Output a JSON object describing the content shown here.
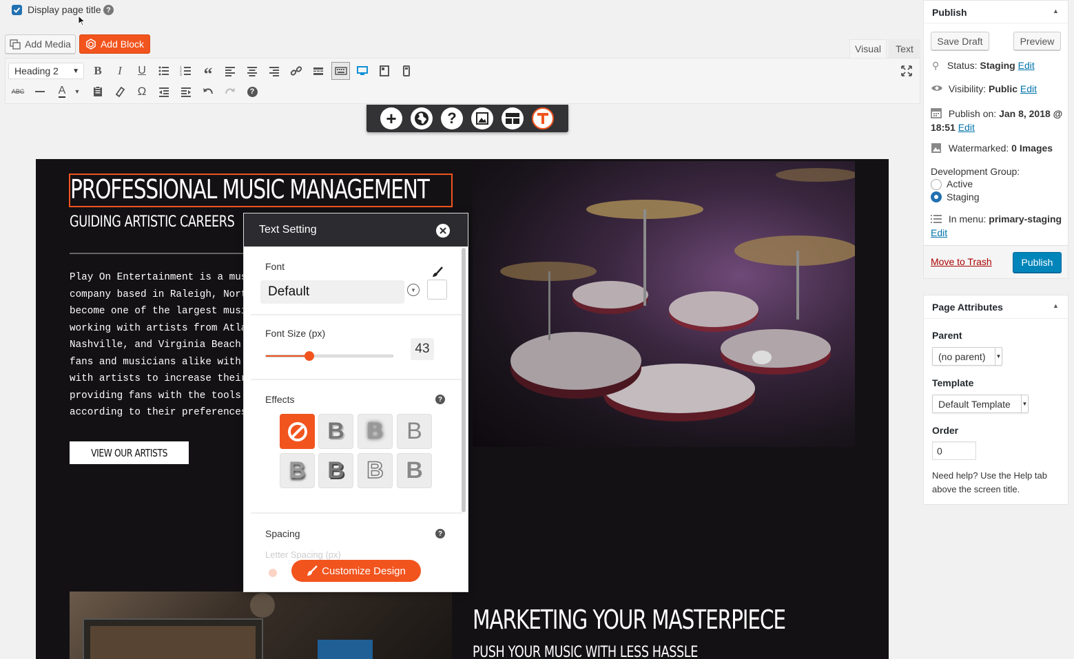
{
  "top": {
    "display_title_label": "Display page title",
    "add_media": "Add Media",
    "add_block": "Add Block",
    "tab_visual": "Visual",
    "tab_text": "Text",
    "format_select": "Heading 2"
  },
  "content": {
    "heading": "PROFESSIONAL MUSIC MANAGEMENT",
    "subheading": "GUIDING ARTISTIC CAREERS",
    "body_lines": [
      "Play On Entertainment is a mus",
      "company based in Raleigh, Nort",
      "become one of the largest musi",
      "working with artists from Atla",
      "Nashville, and Virginia Beach.",
      "fans and musicians alike with",
      "with artists to increase their",
      "providing fans with the tools",
      "according to their preferences"
    ],
    "cta_button": "VIEW OUR ARTISTS",
    "heading2": "MARKETING YOUR MASTERPIECE",
    "subheading2": "PUSH YOUR MUSIC WITH LESS HASSLE"
  },
  "text_setting": {
    "title": "Text Setting",
    "font_label": "Font",
    "font_value": "Default",
    "font_size_label": "Font Size (px)",
    "font_size_value": "43",
    "font_size_slider_fraction": 0.34,
    "effects_label": "Effects",
    "spacing_label": "Spacing",
    "letter_spacing_label": "Letter Spacing (px)",
    "customize_button": "Customize Design"
  },
  "publish": {
    "title": "Publish",
    "save_draft": "Save Draft",
    "preview": "Preview",
    "status_label": "Status:",
    "status_value": "Staging",
    "visibility_label": "Visibility:",
    "visibility_value": "Public",
    "publish_on_label": "Publish on:",
    "publish_on_value": "Jan 8, 2018 @",
    "publish_time": "18:51",
    "edit": "Edit",
    "watermarked_label": "Watermarked:",
    "watermarked_value": "0 Images",
    "dev_group_label": "Development Group:",
    "dev_active": "Active",
    "dev_staging": "Staging",
    "in_menu_label": "In menu:",
    "in_menu_value": "primary-staging",
    "move_to_trash": "Move to Trash",
    "publish_button": "Publish"
  },
  "page_attributes": {
    "title": "Page Attributes",
    "parent_label": "Parent",
    "parent_value": "(no parent)",
    "template_label": "Template",
    "template_value": "Default Template",
    "order_label": "Order",
    "order_value": "0",
    "help_text_1": "Need help? Use the Help tab",
    "help_text_2": "above the screen title."
  },
  "colors": {
    "accent_orange": "#f2541e",
    "wp_blue": "#0085ba",
    "link_blue": "#0073aa",
    "trash_red": "#a00"
  }
}
